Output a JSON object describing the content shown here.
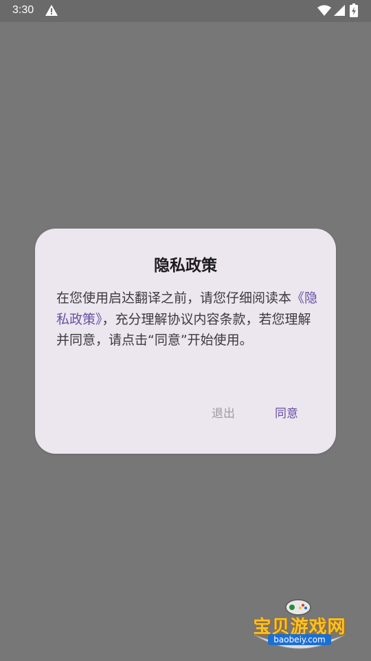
{
  "status_bar": {
    "time": "3:30",
    "icons": [
      "warning-icon",
      "wifi-icon",
      "signal-icon",
      "battery-charging-icon"
    ]
  },
  "dialog": {
    "title": "隐私政策",
    "body_before": "在您使用启达翻译之前，请您仔细阅读本",
    "policy_link": "《隐私政策》",
    "body_after": "，充分理解协议内容条款，若您理解并同意，请点击“同意”开始使用。",
    "exit_label": "退出",
    "agree_label": "同意"
  },
  "watermark": {
    "name": "宝贝游戏网",
    "domain": "baobeiy.com"
  },
  "colors": {
    "accent": "#6750a4",
    "scrim": "#777777",
    "dialog_bg": "#ece6ee"
  }
}
